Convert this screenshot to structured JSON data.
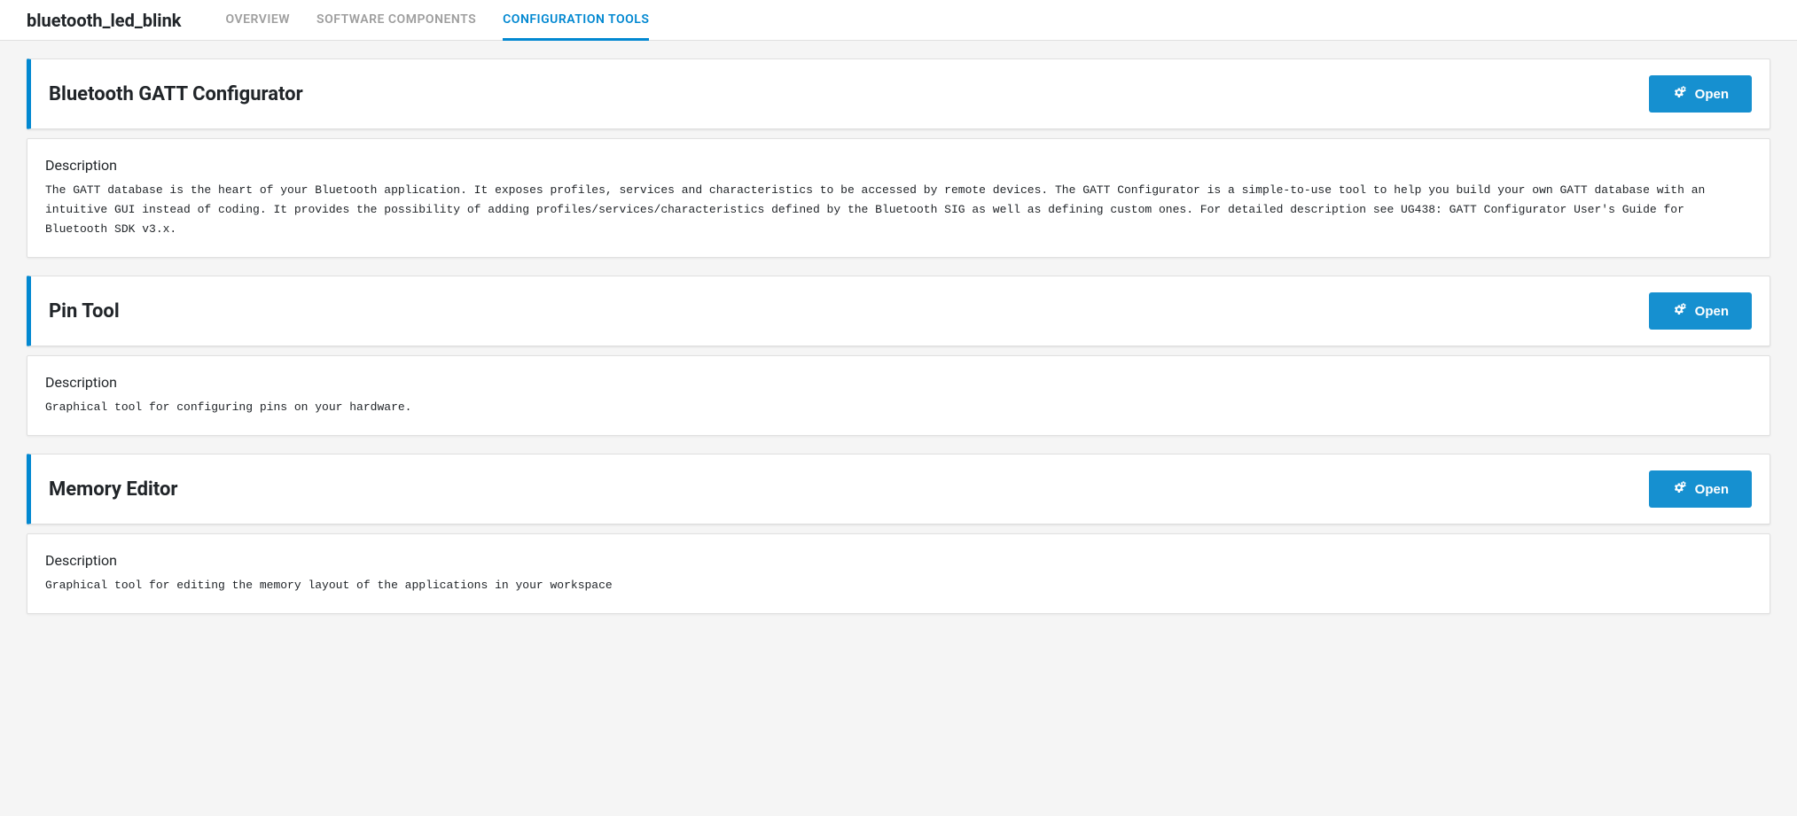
{
  "header": {
    "project_name": "bluetooth_led_blink",
    "tabs": [
      {
        "label": "OVERVIEW",
        "active": false
      },
      {
        "label": "SOFTWARE COMPONENTS",
        "active": false
      },
      {
        "label": "CONFIGURATION TOOLS",
        "active": true
      }
    ]
  },
  "open_button_label": "Open",
  "description_label": "Description",
  "tools": [
    {
      "title": "Bluetooth GATT Configurator",
      "description": "The GATT database is the heart of your Bluetooth application. It exposes profiles, services and characteristics to be accessed by remote devices. The GATT Configurator is a simple-to-use tool to help you build your own GATT database with an intuitive GUI instead of coding. It provides the possibility of adding profiles/services/characteristics defined by the Bluetooth SIG as well as defining custom ones. For detailed description see UG438: GATT Configurator User's Guide for Bluetooth SDK v3.x."
    },
    {
      "title": "Pin Tool",
      "description": "Graphical tool for configuring pins on your hardware."
    },
    {
      "title": "Memory Editor",
      "description": "Graphical tool for editing the memory layout of the applications in your workspace"
    }
  ]
}
